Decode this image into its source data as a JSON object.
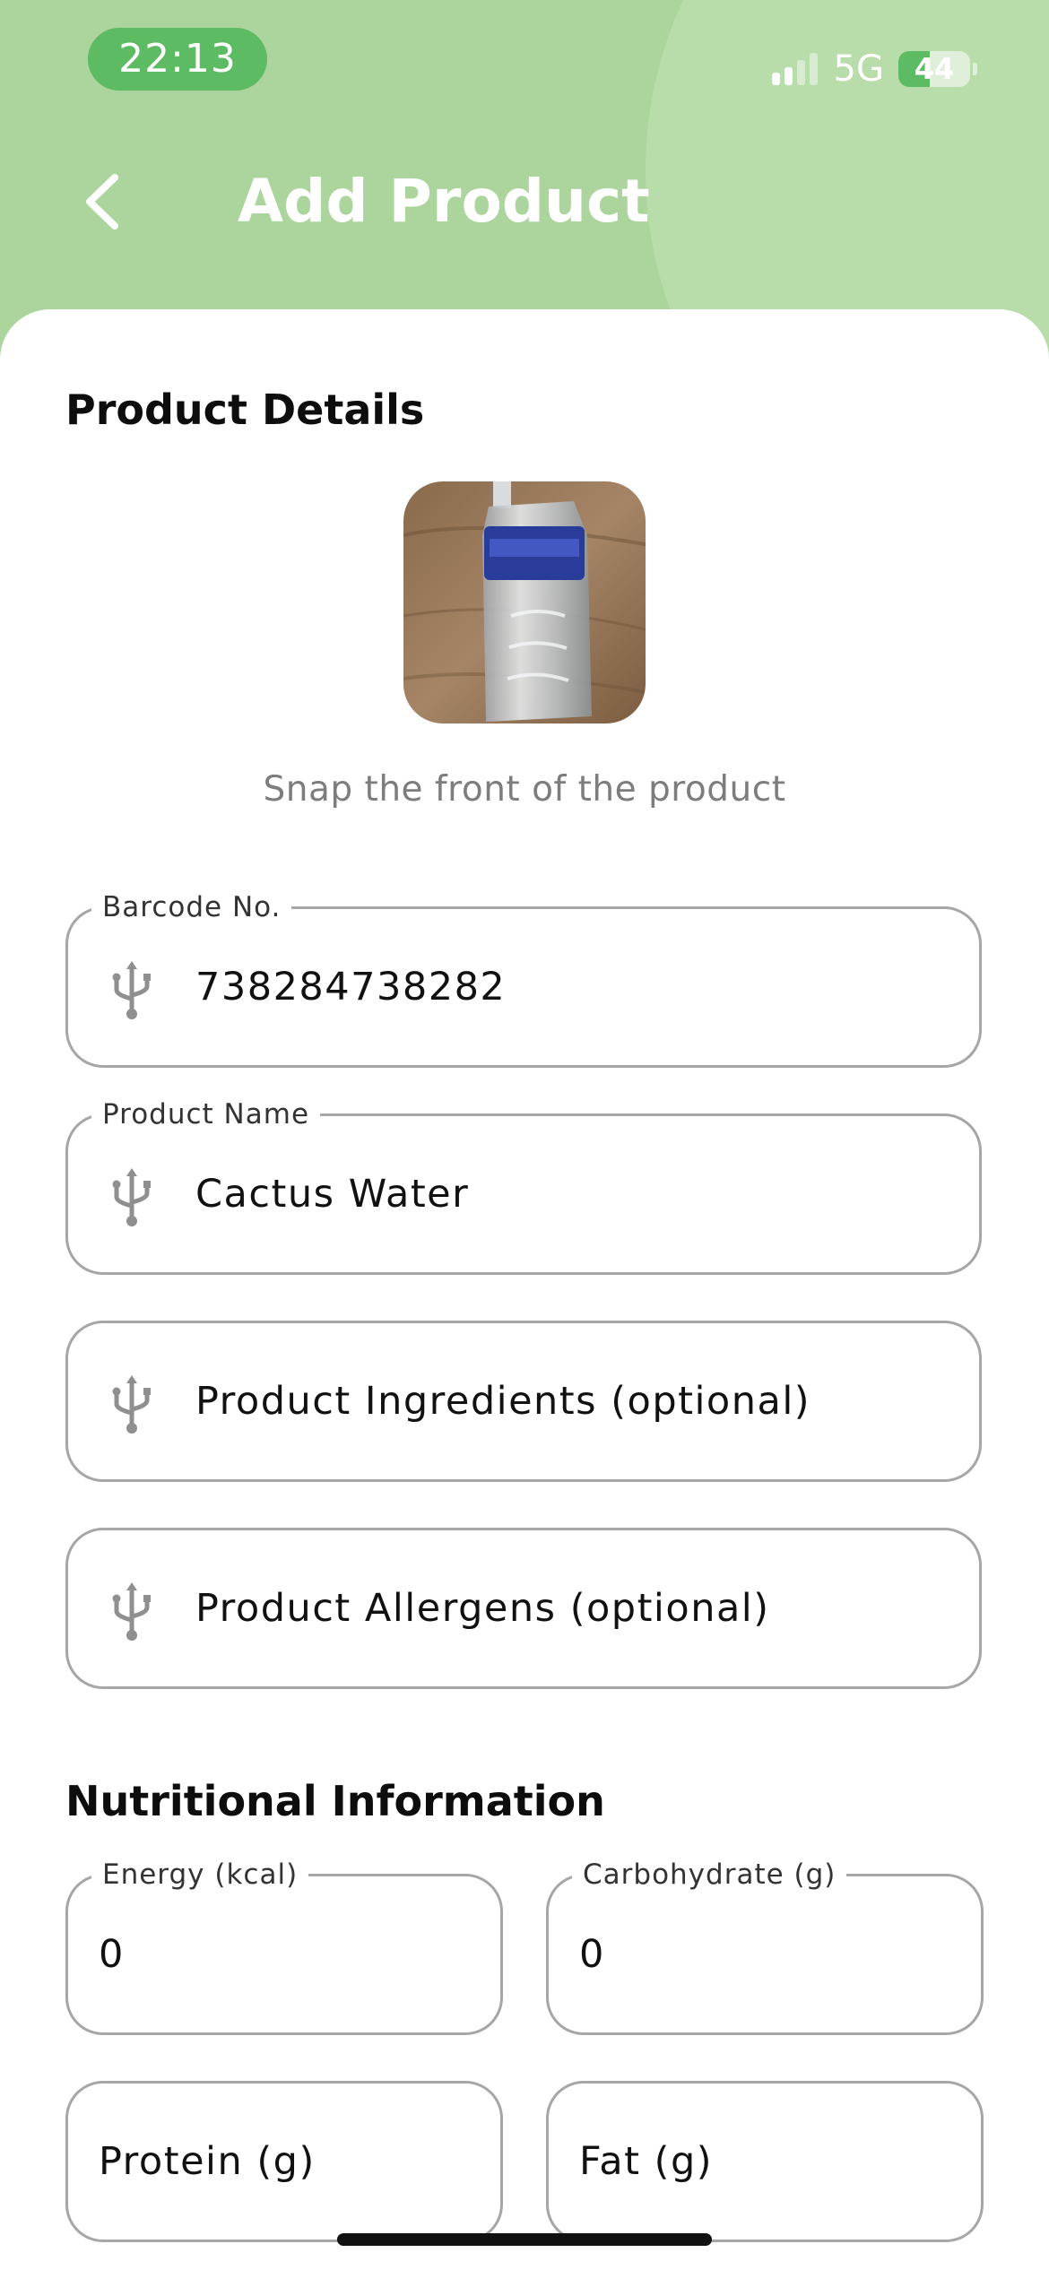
{
  "status_bar": {
    "time": "22:13",
    "network": "5G",
    "battery": "44",
    "battery_level_percent": 44
  },
  "header": {
    "title": "Add Product",
    "back_icon": "chevron-left-icon"
  },
  "product_details": {
    "title": "Product Details",
    "photo_hint": "Snap the front of the product",
    "fields": [
      {
        "label": "Barcode No.",
        "value": "738284738282",
        "icon": "usb-icon"
      },
      {
        "label": "Product Name",
        "value": "Cactus Water",
        "icon": "usb-icon"
      },
      {
        "label": "",
        "placeholder": "Product Ingredients (optional)",
        "icon": "usb-icon"
      },
      {
        "label": "",
        "placeholder": "Product Allergens (optional)",
        "icon": "usb-icon"
      }
    ]
  },
  "nutrition": {
    "title": "Nutritional Information",
    "fields": [
      {
        "label": "Energy (kcal)",
        "value": "0"
      },
      {
        "label": "Carbohydrate (g)",
        "value": "0"
      },
      {
        "label": "",
        "placeholder": "Protein (g)"
      },
      {
        "label": "",
        "placeholder": "Fat (g)"
      }
    ]
  },
  "colors": {
    "header_bg": "#acd49d",
    "accent_green": "#5dbb63",
    "field_border": "#a6a6a6",
    "hint_text": "#7d7d7d"
  }
}
